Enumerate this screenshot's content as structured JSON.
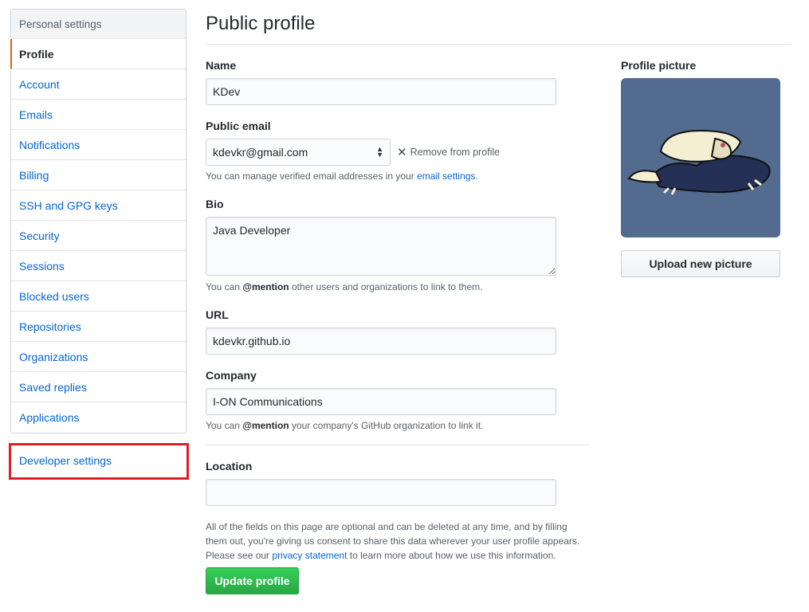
{
  "sidebar": {
    "header": "Personal settings",
    "items": [
      {
        "label": "Profile"
      },
      {
        "label": "Account"
      },
      {
        "label": "Emails"
      },
      {
        "label": "Notifications"
      },
      {
        "label": "Billing"
      },
      {
        "label": "SSH and GPG keys"
      },
      {
        "label": "Security"
      },
      {
        "label": "Sessions"
      },
      {
        "label": "Blocked users"
      },
      {
        "label": "Repositories"
      },
      {
        "label": "Organizations"
      },
      {
        "label": "Saved replies"
      },
      {
        "label": "Applications"
      }
    ],
    "developer_settings": "Developer settings",
    "highlight_color": "#e01e2b"
  },
  "main": {
    "title": "Public profile",
    "name": {
      "label": "Name",
      "value": "KDev"
    },
    "email": {
      "label": "Public email",
      "selected": "kdevkr@gmail.com",
      "remove_label": "Remove from profile",
      "note_prefix": "You can manage verified email addresses in your ",
      "note_link": "email settings",
      "note_suffix": "."
    },
    "bio": {
      "label": "Bio",
      "value": "Java Developer",
      "note_prefix": "You can ",
      "note_mention": "@mention",
      "note_suffix": " other users and organizations to link to them."
    },
    "url": {
      "label": "URL",
      "value": "kdevkr.github.io"
    },
    "company": {
      "label": "Company",
      "value": "I-ON Communications",
      "note_prefix": "You can ",
      "note_mention": "@mention",
      "note_suffix": " your company's GitHub organization to link it."
    },
    "location": {
      "label": "Location",
      "value": ""
    },
    "legal": {
      "prefix": "All of the fields on this page are optional and can be deleted at any time, and by filling them out, you're giving us consent to share this data wherever your user profile appears. Please see our ",
      "link": "privacy statement",
      "suffix": " to learn more about how we use this information."
    },
    "update_button": "Update profile"
  },
  "profile_picture": {
    "label": "Profile picture",
    "upload_button": "Upload new picture",
    "background_color": "#526b8f"
  }
}
